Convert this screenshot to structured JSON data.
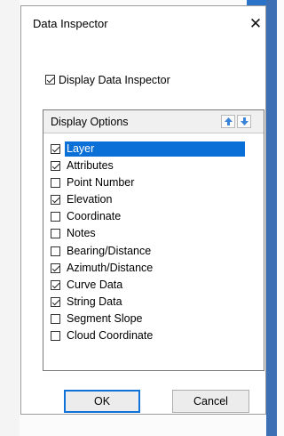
{
  "dialog": {
    "title": "Data Inspector",
    "close_glyph": "✕",
    "display_checkbox": {
      "label": "Display Data Inspector",
      "checked": true
    },
    "group": {
      "title": "Display Options",
      "up_icon": "arrow-up-icon",
      "down_icon": "arrow-down-icon"
    },
    "items": [
      {
        "label": "Layer",
        "checked": true,
        "selected": true
      },
      {
        "label": "Attributes",
        "checked": true
      },
      {
        "label": "Point Number",
        "checked": false
      },
      {
        "label": "Elevation",
        "checked": true
      },
      {
        "label": "Coordinate",
        "checked": false
      },
      {
        "label": "Notes",
        "checked": false
      },
      {
        "label": "Bearing/Distance",
        "checked": false
      },
      {
        "label": "Azimuth/Distance",
        "checked": true
      },
      {
        "label": "Curve Data",
        "checked": true
      },
      {
        "label": "String Data",
        "checked": true
      },
      {
        "label": "Segment Slope",
        "checked": false
      },
      {
        "label": "Cloud Coordinate",
        "checked": false
      }
    ],
    "buttons": {
      "ok": "OK",
      "cancel": "Cancel"
    }
  },
  "colors": {
    "selection": "#0a6fd6",
    "ok_border": "#0f72d8",
    "desktop_accent": "#3c6fb3"
  }
}
